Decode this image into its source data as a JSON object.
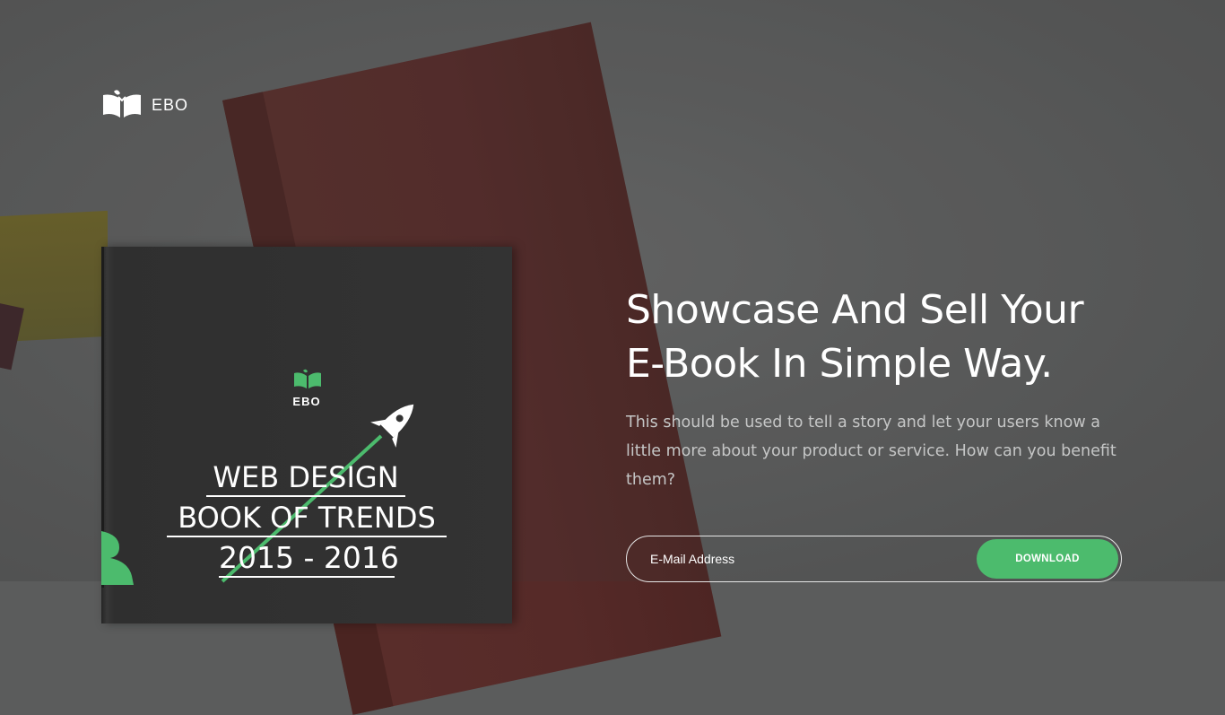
{
  "brand": {
    "name": "EBO"
  },
  "cover": {
    "brand": "EBO",
    "line1": "WEB DESIGN",
    "line2": "BOOK OF TRENDS",
    "line3": "2015 - 2016"
  },
  "hero": {
    "title_line1": "Showcase And Sell Your",
    "title_line2": "E-Book In Simple Way.",
    "description": "This should be used to tell a story and let your users know a little more about your product or service. How can you benefit them?"
  },
  "form": {
    "email_placeholder": "E-Mail Address",
    "download_label": "DOWNLOAD"
  },
  "colors": {
    "accent": "#4cbb6d",
    "background": "#5b5c5c",
    "cover": "#333333"
  },
  "icons": {
    "logo": "open-book-icon",
    "rocket": "rocket-icon"
  }
}
